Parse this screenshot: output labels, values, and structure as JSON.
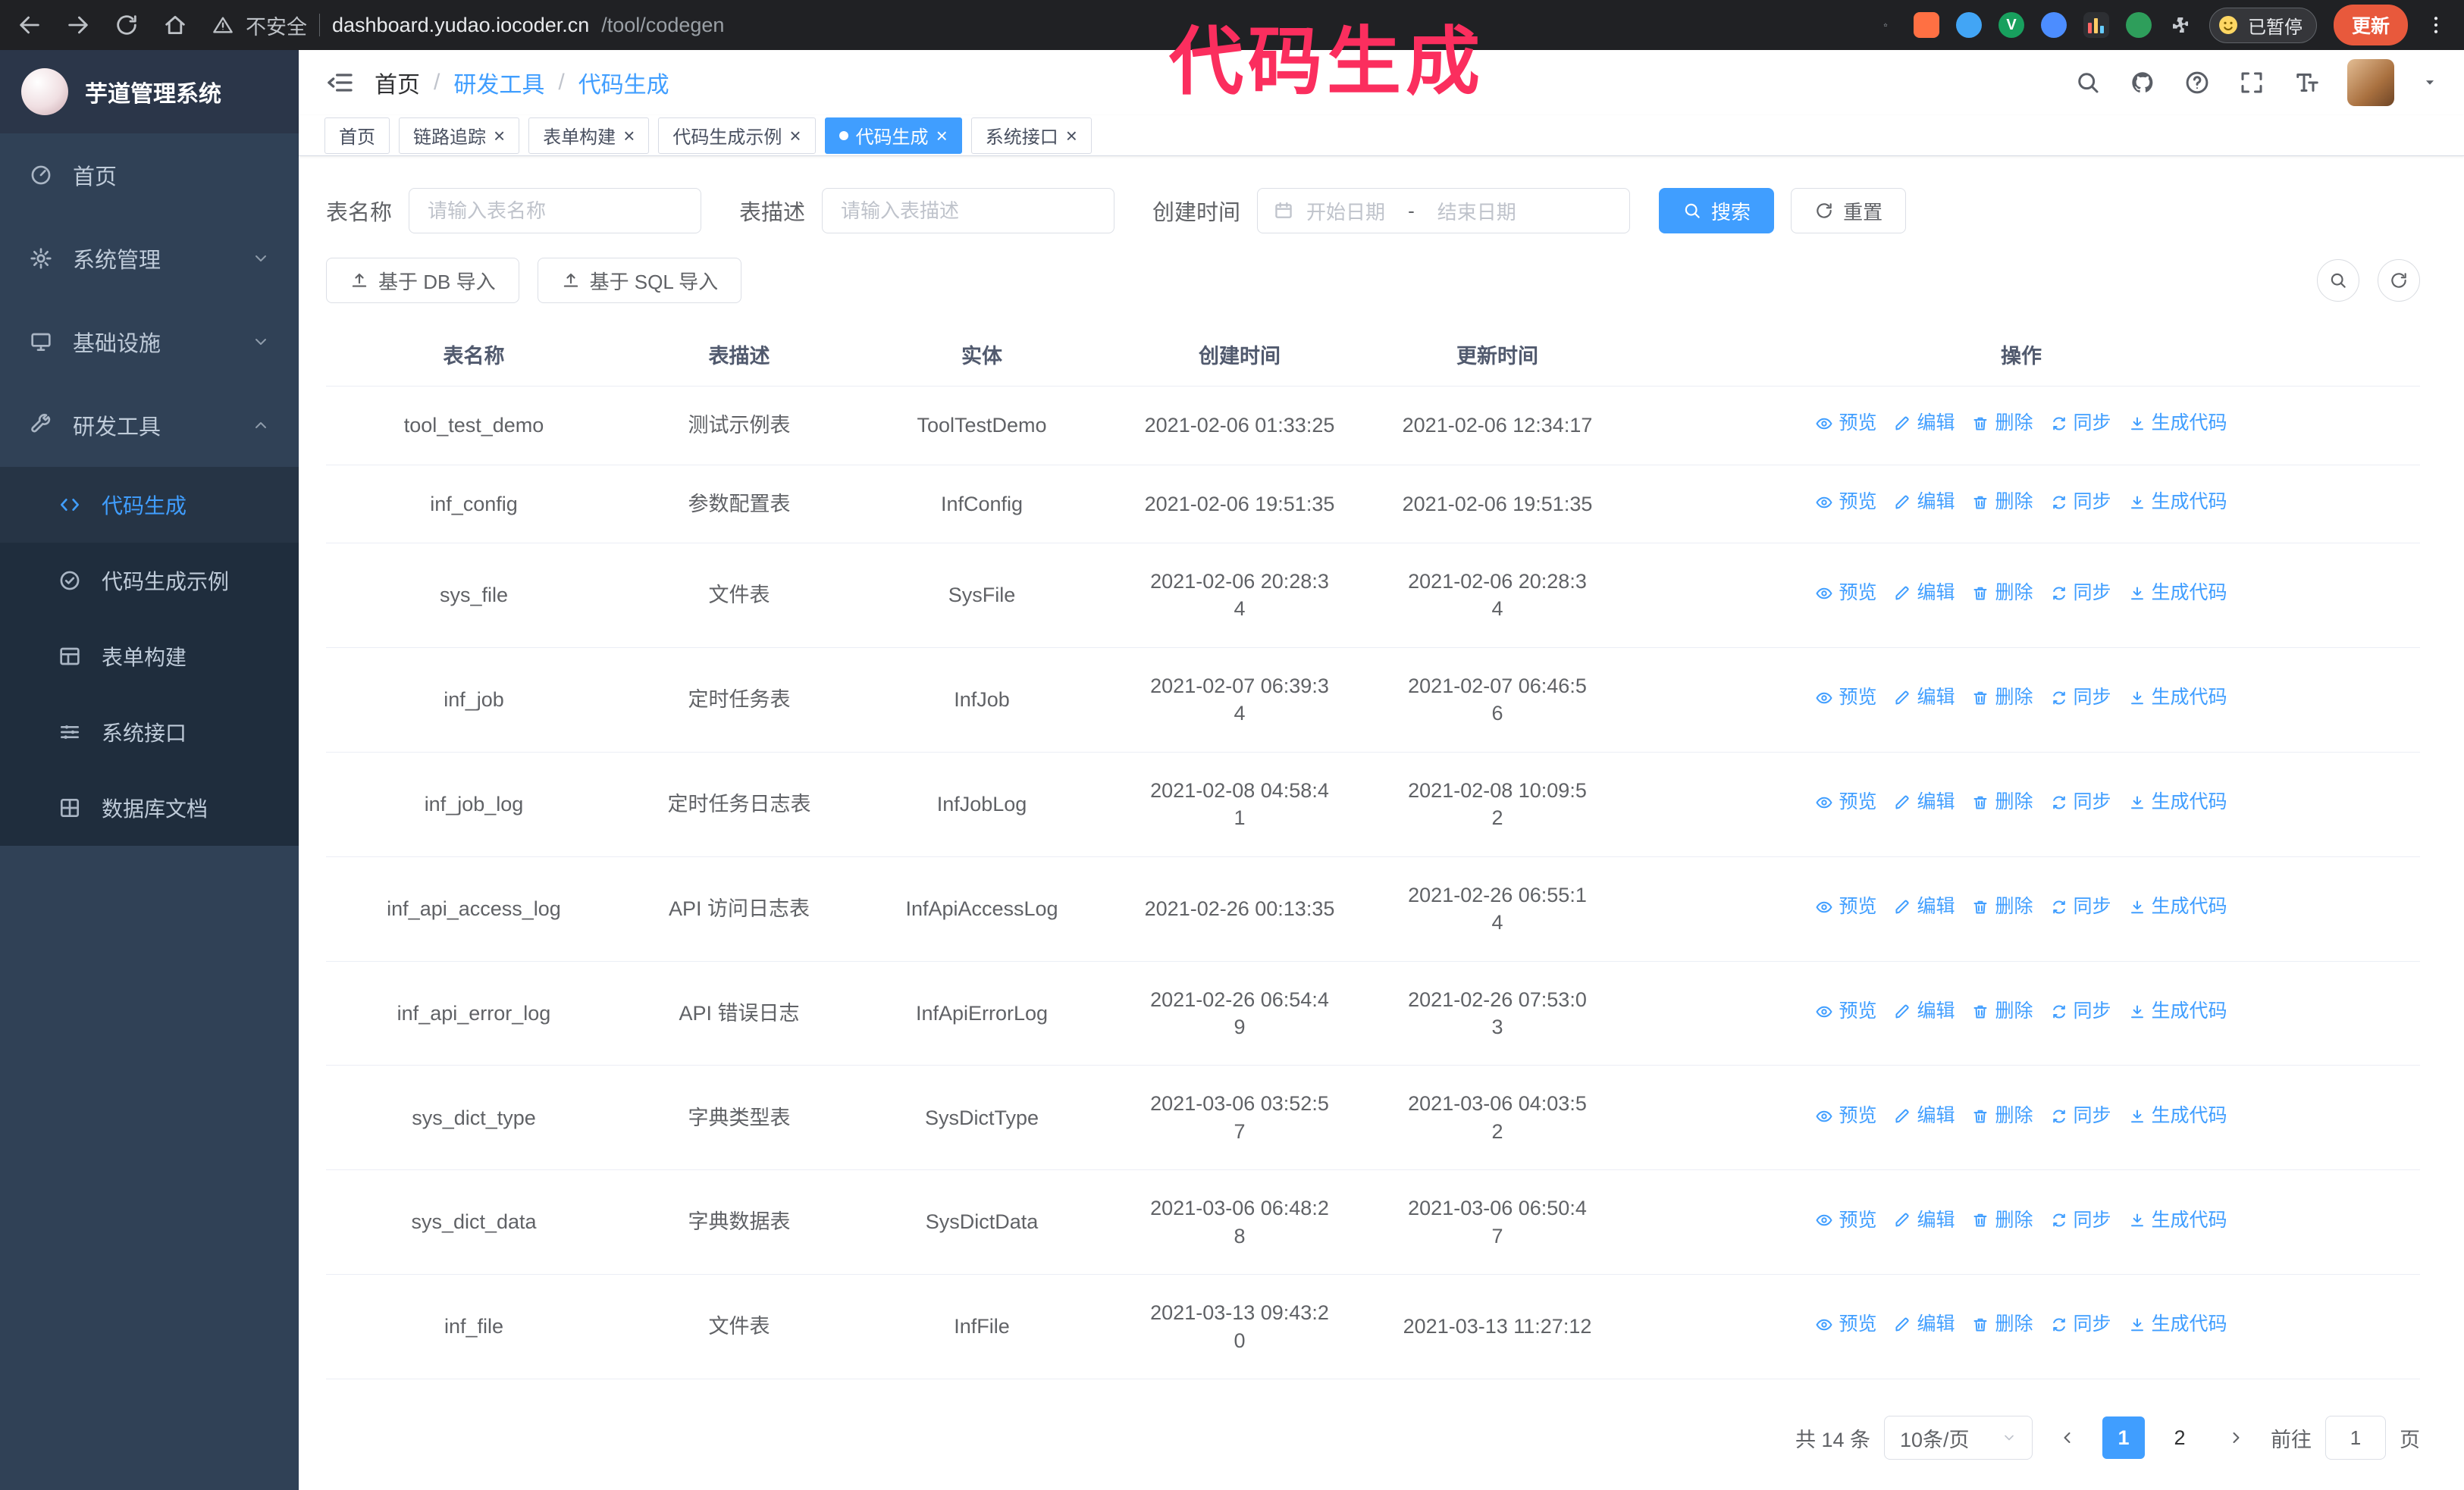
{
  "theme": {
    "accent": "#409eff",
    "sidebar-bg": "#304156",
    "sidebar-sub-bg": "#1f2d3d",
    "chrome-bg": "#202124",
    "update-btn": "#e8593c",
    "annotation": "#fb2e5e"
  },
  "annotation": {
    "text": "代码生成"
  },
  "browser": {
    "security_label": "不安全",
    "url_domain": "dashboard.yudao.iocoder.cn",
    "url_path": "/tool/codegen",
    "paused_badge": "已暂停",
    "update_button": "更新"
  },
  "sidebar": {
    "logo_title": "芋道管理系统",
    "items": [
      {
        "label": "首页"
      },
      {
        "label": "系统管理"
      },
      {
        "label": "基础设施"
      },
      {
        "label": "研发工具"
      }
    ],
    "subitems": [
      {
        "label": "代码生成"
      },
      {
        "label": "代码生成示例"
      },
      {
        "label": "表单构建"
      },
      {
        "label": "系统接口"
      },
      {
        "label": "数据库文档"
      }
    ]
  },
  "breadcrumb": {
    "items": [
      "首页",
      "研发工具",
      "代码生成"
    ]
  },
  "tags": [
    {
      "label": "首页"
    },
    {
      "label": "链路追踪"
    },
    {
      "label": "表单构建"
    },
    {
      "label": "代码生成示例"
    },
    {
      "label": "代码生成"
    },
    {
      "label": "系统接口"
    }
  ],
  "filters": {
    "name_label": "表名称",
    "name_placeholder": "请输入表名称",
    "desc_label": "表描述",
    "desc_placeholder": "请输入表描述",
    "time_label": "创建时间",
    "start_placeholder": "开始日期",
    "range_separator": "-",
    "end_placeholder": "结束日期",
    "search_button": "搜索",
    "reset_button": "重置"
  },
  "toolbar": {
    "import_db_button": "基于 DB 导入",
    "import_sql_button": "基于 SQL 导入"
  },
  "table": {
    "columns": [
      "表名称",
      "表描述",
      "实体",
      "创建时间",
      "更新时间",
      "操作"
    ],
    "actions": {
      "preview": "预览",
      "edit": "编辑",
      "delete": "删除",
      "sync": "同步",
      "generate": "生成代码"
    },
    "rows": [
      {
        "name": "tool_test_demo",
        "desc": "测试示例表",
        "entity": "ToolTestDemo",
        "created": "2021-02-06 01:33:25",
        "updated": "2021-02-06 12:34:17"
      },
      {
        "name": "inf_config",
        "desc": "参数配置表",
        "entity": "InfConfig",
        "created": "2021-02-06 19:51:35",
        "updated": "2021-02-06 19:51:35"
      },
      {
        "name": "sys_file",
        "desc": "文件表",
        "entity": "SysFile",
        "created": "2021-02-06 20:28:34",
        "updated": "2021-02-06 20:28:34"
      },
      {
        "name": "inf_job",
        "desc": "定时任务表",
        "entity": "InfJob",
        "created": "2021-02-07 06:39:34",
        "updated": "2021-02-07 06:46:56"
      },
      {
        "name": "inf_job_log",
        "desc": "定时任务日志表",
        "entity": "InfJobLog",
        "created": "2021-02-08 04:58:41",
        "updated": "2021-02-08 10:09:52"
      },
      {
        "name": "inf_api_access_log",
        "desc": "API 访问日志表",
        "entity": "InfApiAccessLog",
        "created": "2021-02-26 00:13:35",
        "updated": "2021-02-26 06:55:14"
      },
      {
        "name": "inf_api_error_log",
        "desc": "API 错误日志",
        "entity": "InfApiErrorLog",
        "created": "2021-02-26 06:54:49",
        "updated": "2021-02-26 07:53:03"
      },
      {
        "name": "sys_dict_type",
        "desc": "字典类型表",
        "entity": "SysDictType",
        "created": "2021-03-06 03:52:57",
        "updated": "2021-03-06 04:03:52"
      },
      {
        "name": "sys_dict_data",
        "desc": "字典数据表",
        "entity": "SysDictData",
        "created": "2021-03-06 06:48:28",
        "updated": "2021-03-06 06:50:47"
      },
      {
        "name": "inf_file",
        "desc": "文件表",
        "entity": "InfFile",
        "created": "2021-03-13 09:43:20",
        "updated": "2021-03-13 11:27:12"
      }
    ]
  },
  "pagination": {
    "total": "共 14 条",
    "page_size": "10条/页",
    "page_1": "1",
    "page_2": "2",
    "goto_label": "前往",
    "goto_value": "1",
    "goto_suffix": "页"
  },
  "icons": {
    "close": "×",
    "ext_v": "V"
  }
}
